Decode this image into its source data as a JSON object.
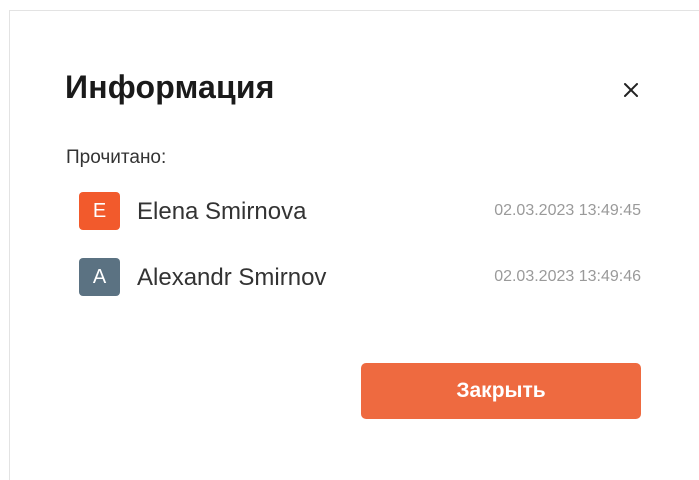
{
  "dialog": {
    "title": "Информация",
    "close_icon": "close-icon",
    "read_label": "Прочитано:",
    "readers": [
      {
        "initial": "E",
        "name": "Elena Smirnova",
        "timestamp": "02.03.2023 13:49:45",
        "avatar_color": "#f25a2c"
      },
      {
        "initial": "A",
        "name": "Alexandr Smirnov",
        "timestamp": "02.03.2023 13:49:46",
        "avatar_color": "#5b7282"
      }
    ],
    "close_button_label": "Закрыть",
    "accent_color": "#ee6a40"
  }
}
